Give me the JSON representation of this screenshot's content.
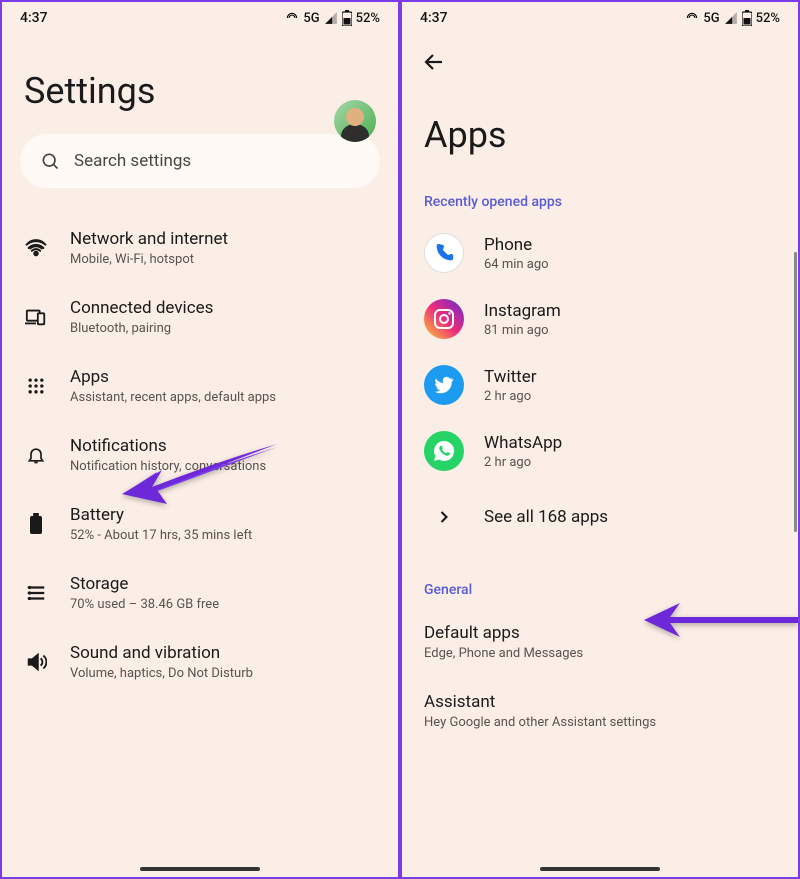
{
  "status": {
    "time": "4:37",
    "network": "5G",
    "battery": "52%"
  },
  "left": {
    "title": "Settings",
    "search_placeholder": "Search settings",
    "items": [
      {
        "icon": "wifi",
        "title": "Network and internet",
        "sub": "Mobile, Wi-Fi, hotspot"
      },
      {
        "icon": "devices",
        "title": "Connected devices",
        "sub": "Bluetooth, pairing"
      },
      {
        "icon": "apps",
        "title": "Apps",
        "sub": "Assistant, recent apps, default apps"
      },
      {
        "icon": "bell",
        "title": "Notifications",
        "sub": "Notification history, conversations"
      },
      {
        "icon": "battery",
        "title": "Battery",
        "sub": "52% - About 17 hrs, 35 mins left"
      },
      {
        "icon": "storage",
        "title": "Storage",
        "sub": "70% used – 38.46 GB free"
      },
      {
        "icon": "sound",
        "title": "Sound and vibration",
        "sub": "Volume, haptics, Do Not Disturb"
      }
    ]
  },
  "right": {
    "title": "Apps",
    "section_recent": "Recently opened apps",
    "recent": [
      {
        "icon": "phone",
        "title": "Phone",
        "sub": "64 min ago",
        "bg": "#ffffff",
        "fg": "#1a73e8"
      },
      {
        "icon": "instagram",
        "title": "Instagram",
        "sub": "81 min ago",
        "bg": "linear-gradient(45deg,#f9ce34,#ee2a7b,#6228d7)"
      },
      {
        "icon": "twitter",
        "title": "Twitter",
        "sub": "2 hr ago",
        "bg": "#1d9bf0"
      },
      {
        "icon": "whatsapp",
        "title": "WhatsApp",
        "sub": "2 hr ago",
        "bg": "#25d366"
      }
    ],
    "see_all": "See all 168 apps",
    "section_general": "General",
    "general": [
      {
        "title": "Default apps",
        "sub": "Edge, Phone and Messages"
      },
      {
        "title": "Assistant",
        "sub": "Hey Google and other Assistant settings"
      }
    ]
  }
}
